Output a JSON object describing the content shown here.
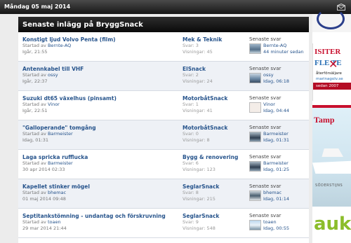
{
  "topbar": {
    "date": "Måndag 05 maj 2014"
  },
  "panel": {
    "heading": "Senaste inlägg på BryggSnack"
  },
  "labels": {
    "started_by": "Startad av",
    "replies": "Svar:",
    "views": "Visningar:",
    "last_reply": "Senaste svar"
  },
  "posts": [
    {
      "title": "Konstigt ljud Volvo Penta (film)",
      "author": "Bernte-AQ",
      "date": "Igår, 21:55",
      "forum": "Mek & Teknik",
      "replies": "3",
      "views": "45",
      "last_user": "Bernte-AQ",
      "last_time": "44 minuter sedan"
    },
    {
      "title": "Antennkabel till VHF",
      "author": "ossy",
      "date": "Igår, 22:37",
      "forum": "ElSnack",
      "replies": "2",
      "views": "24",
      "last_user": "ossy",
      "last_time": "Idag, 06:18"
    },
    {
      "title": "Suzuki dt65 växelhus (pinsamt)",
      "author": "Vinor",
      "date": "Igår, 22:51",
      "forum": "MotorbåtSnack",
      "replies": "1",
      "views": "41",
      "last_user": "Vinor",
      "last_time": "Idag, 04:44"
    },
    {
      "title": "\"Galloperande\" tomgång",
      "author": "Barmeister",
      "date": "Idag, 01:31",
      "forum": "MotorbåtSnack",
      "replies": "0",
      "views": "8",
      "last_user": "Barmeister",
      "last_time": "Idag, 01:31"
    },
    {
      "title": "Laga spricka rufflucka",
      "author": "Barmeister",
      "date": "30 apr 2014 02:33",
      "forum": "Bygg & renovering",
      "replies": "6",
      "views": "123",
      "last_user": "Barmeister",
      "last_time": "Idag, 01:25"
    },
    {
      "title": "Kapellet stinker mögel",
      "author": "bhemac",
      "date": "01 maj 2014 09:48",
      "forum": "SeglarSnack",
      "replies": "8",
      "views": "215",
      "last_user": "bhemac",
      "last_time": "Idag, 01:14"
    },
    {
      "title": "Septitankstömning - undantag och förskruvning",
      "author": "toaen",
      "date": "29 mar 2014 21:44",
      "forum": "SeglarSnack",
      "replies": "9",
      "views": "548",
      "last_user": "toaen",
      "last_time": "Idag, 00:55"
    }
  ],
  "ads": {
    "ad2_line1": "ISITER",
    "ad2_line2": "FLE   TE",
    "ad2_sub1": "återförsäljare",
    "ad2_sub2": "marinagolv.se",
    "ad2_sub3": "sedan 2007",
    "ad3_title": "Tamp",
    "ad3_sub": "SÖDERSTIJNS",
    "ad4_text": "auk"
  },
  "colors": {
    "link": "#27548c",
    "header_bg": "#161616",
    "row_alt": "#eef1f6"
  }
}
